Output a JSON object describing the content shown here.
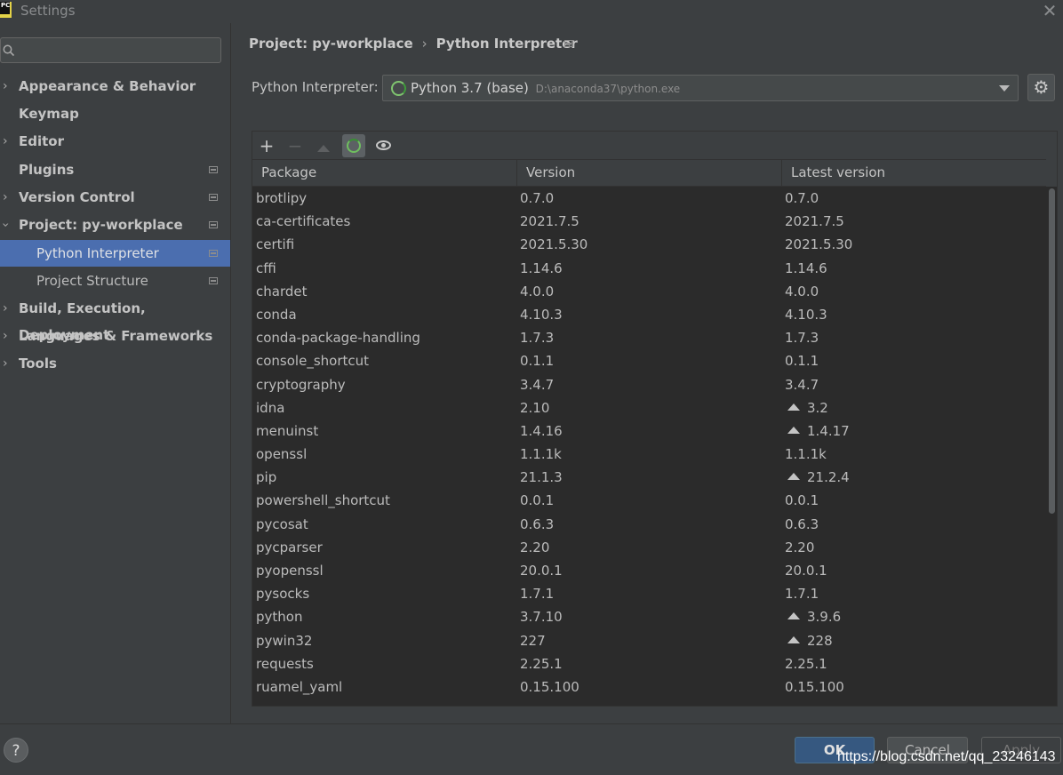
{
  "window": {
    "title": "Settings"
  },
  "sidebar": {
    "search_placeholder": "",
    "items": [
      {
        "label": "Appearance & Behavior"
      },
      {
        "label": "Keymap"
      },
      {
        "label": "Editor"
      },
      {
        "label": "Plugins"
      },
      {
        "label": "Version Control"
      },
      {
        "label": "Project: py-workplace"
      },
      {
        "label": "Python Interpreter"
      },
      {
        "label": "Project Structure"
      },
      {
        "label": "Build, Execution, Deployment"
      },
      {
        "label": "Languages & Frameworks"
      },
      {
        "label": "Tools"
      }
    ],
    "help_label": "?"
  },
  "breadcrumb": {
    "project": "Project: py-workplace",
    "separator": "›",
    "page": "Python Interpreter"
  },
  "interpreter": {
    "label": "Python Interpreter:",
    "name": "Python 3.7 (base)",
    "path": "D:\\anaconda37\\python.exe"
  },
  "toolbar": {
    "add": "+",
    "remove": "−"
  },
  "table": {
    "columns": [
      "Package",
      "Version",
      "Latest version"
    ],
    "rows": [
      {
        "package": "brotlipy",
        "version": "0.7.0",
        "latest": "0.7.0",
        "upgrade": false
      },
      {
        "package": "ca-certificates",
        "version": "2021.7.5",
        "latest": "2021.7.5",
        "upgrade": false
      },
      {
        "package": "certifi",
        "version": "2021.5.30",
        "latest": "2021.5.30",
        "upgrade": false
      },
      {
        "package": "cffi",
        "version": "1.14.6",
        "latest": "1.14.6",
        "upgrade": false
      },
      {
        "package": "chardet",
        "version": "4.0.0",
        "latest": "4.0.0",
        "upgrade": false
      },
      {
        "package": "conda",
        "version": "4.10.3",
        "latest": "4.10.3",
        "upgrade": false
      },
      {
        "package": "conda-package-handling",
        "version": "1.7.3",
        "latest": "1.7.3",
        "upgrade": false
      },
      {
        "package": "console_shortcut",
        "version": "0.1.1",
        "latest": "0.1.1",
        "upgrade": false
      },
      {
        "package": "cryptography",
        "version": "3.4.7",
        "latest": "3.4.7",
        "upgrade": false
      },
      {
        "package": "idna",
        "version": "2.10",
        "latest": "3.2",
        "upgrade": true
      },
      {
        "package": "menuinst",
        "version": "1.4.16",
        "latest": "1.4.17",
        "upgrade": true
      },
      {
        "package": "openssl",
        "version": "1.1.1k",
        "latest": "1.1.1k",
        "upgrade": false
      },
      {
        "package": "pip",
        "version": "21.1.3",
        "latest": "21.2.4",
        "upgrade": true
      },
      {
        "package": "powershell_shortcut",
        "version": "0.0.1",
        "latest": "0.0.1",
        "upgrade": false
      },
      {
        "package": "pycosat",
        "version": "0.6.3",
        "latest": "0.6.3",
        "upgrade": false
      },
      {
        "package": "pycparser",
        "version": "2.20",
        "latest": "2.20",
        "upgrade": false
      },
      {
        "package": "pyopenssl",
        "version": "20.0.1",
        "latest": "20.0.1",
        "upgrade": false
      },
      {
        "package": "pysocks",
        "version": "1.7.1",
        "latest": "1.7.1",
        "upgrade": false
      },
      {
        "package": "python",
        "version": "3.7.10",
        "latest": "3.9.6",
        "upgrade": true
      },
      {
        "package": "pywin32",
        "version": "227",
        "latest": "228",
        "upgrade": true
      },
      {
        "package": "requests",
        "version": "2.25.1",
        "latest": "2.25.1",
        "upgrade": false
      },
      {
        "package": "ruamel_yaml",
        "version": "0.15.100",
        "latest": "0.15.100",
        "upgrade": false
      }
    ]
  },
  "buttons": {
    "ok": "OK",
    "cancel": "Cancel",
    "apply": "Apply"
  },
  "watermark": "https://blog.csdn.net/qq_23246143",
  "colors": {
    "background": "#3c3f41",
    "table_bg": "#2b2b2b",
    "selection": "#4b6eaf",
    "ok_button": "#365880"
  }
}
